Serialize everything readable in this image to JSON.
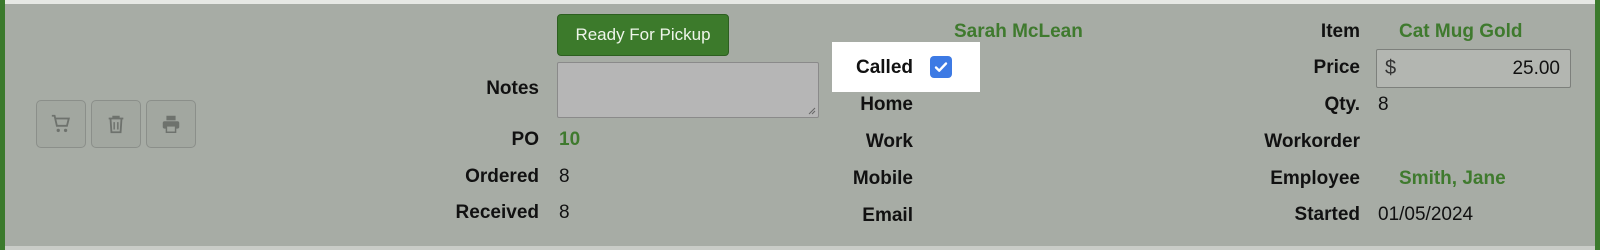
{
  "actions": {
    "ready_for_pickup": "Ready For Pickup"
  },
  "notes": {
    "label": "Notes",
    "value": ""
  },
  "po": {
    "label": "PO",
    "value": "10"
  },
  "ordered": {
    "label": "Ordered",
    "value": "8"
  },
  "received": {
    "label": "Received",
    "value": "8"
  },
  "customer": {
    "name": "Sarah McLean",
    "called_label": "Called",
    "called_checked": true,
    "home_label": "Home",
    "work_label": "Work",
    "mobile_label": "Mobile",
    "email_label": "Email"
  },
  "item": {
    "label": "Item",
    "value": "Cat Mug Gold"
  },
  "price": {
    "label": "Price",
    "currency": "$",
    "value": "25.00"
  },
  "qty": {
    "label": "Qty.",
    "value": "8"
  },
  "workorder": {
    "label": "Workorder",
    "value": ""
  },
  "employee": {
    "label": "Employee",
    "value": "Smith, Jane"
  },
  "started": {
    "label": "Started",
    "value": "01/05/2024"
  },
  "icons": [
    "cart-icon",
    "trash-icon",
    "print-icon"
  ],
  "colors": {
    "accent": "#3c7a2b",
    "background": "#a7aca5",
    "checkbox": "#3d7ae4"
  }
}
